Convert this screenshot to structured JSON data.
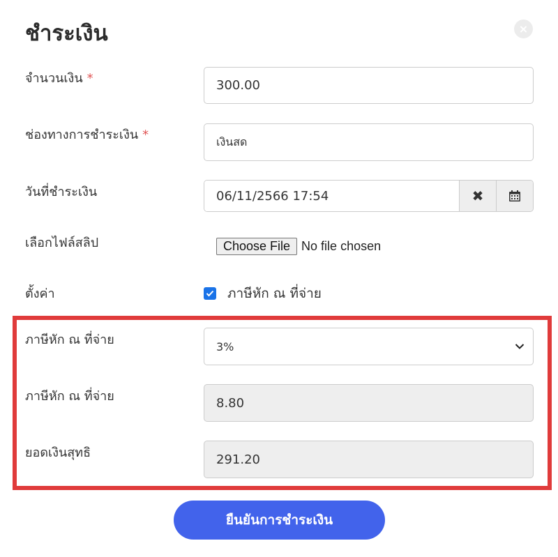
{
  "modal": {
    "title": "ชำระเงิน",
    "close_label": "×"
  },
  "form": {
    "amount": {
      "label": "จำนวนเงิน",
      "required_mark": "*",
      "value": "300.00"
    },
    "channel": {
      "label": "ช่องทางการชำระเงิน",
      "required_mark": "*",
      "value": "เงินสด"
    },
    "date": {
      "label": "วันที่ชำระเงิน",
      "value": "06/11/2566 17:54",
      "clear_icon": "times-icon",
      "calendar_icon": "calendar-icon"
    },
    "slip": {
      "label": "เลือกไฟล์สลิป",
      "button_label": "Choose File",
      "status": "No file chosen"
    },
    "settings": {
      "label": "ตั้งค่า",
      "checkbox_label": "ภาษีหัก ณ ที่จ่าย",
      "checked": true
    },
    "withholding_rate": {
      "label": "ภาษีหัก ณ ที่จ่าย",
      "selected": "3%"
    },
    "withholding_amount": {
      "label": "ภาษีหัก ณ ที่จ่าย",
      "value": "8.80"
    },
    "net_amount": {
      "label": "ยอดเงินสุทธิ",
      "value": "291.20"
    }
  },
  "actions": {
    "confirm_label": "ยืนยันการชำระเงิน"
  },
  "colors": {
    "primary": "#4263eb",
    "highlight": "#e03b3b",
    "checkbox": "#1a73e8",
    "required": "#e05555"
  }
}
